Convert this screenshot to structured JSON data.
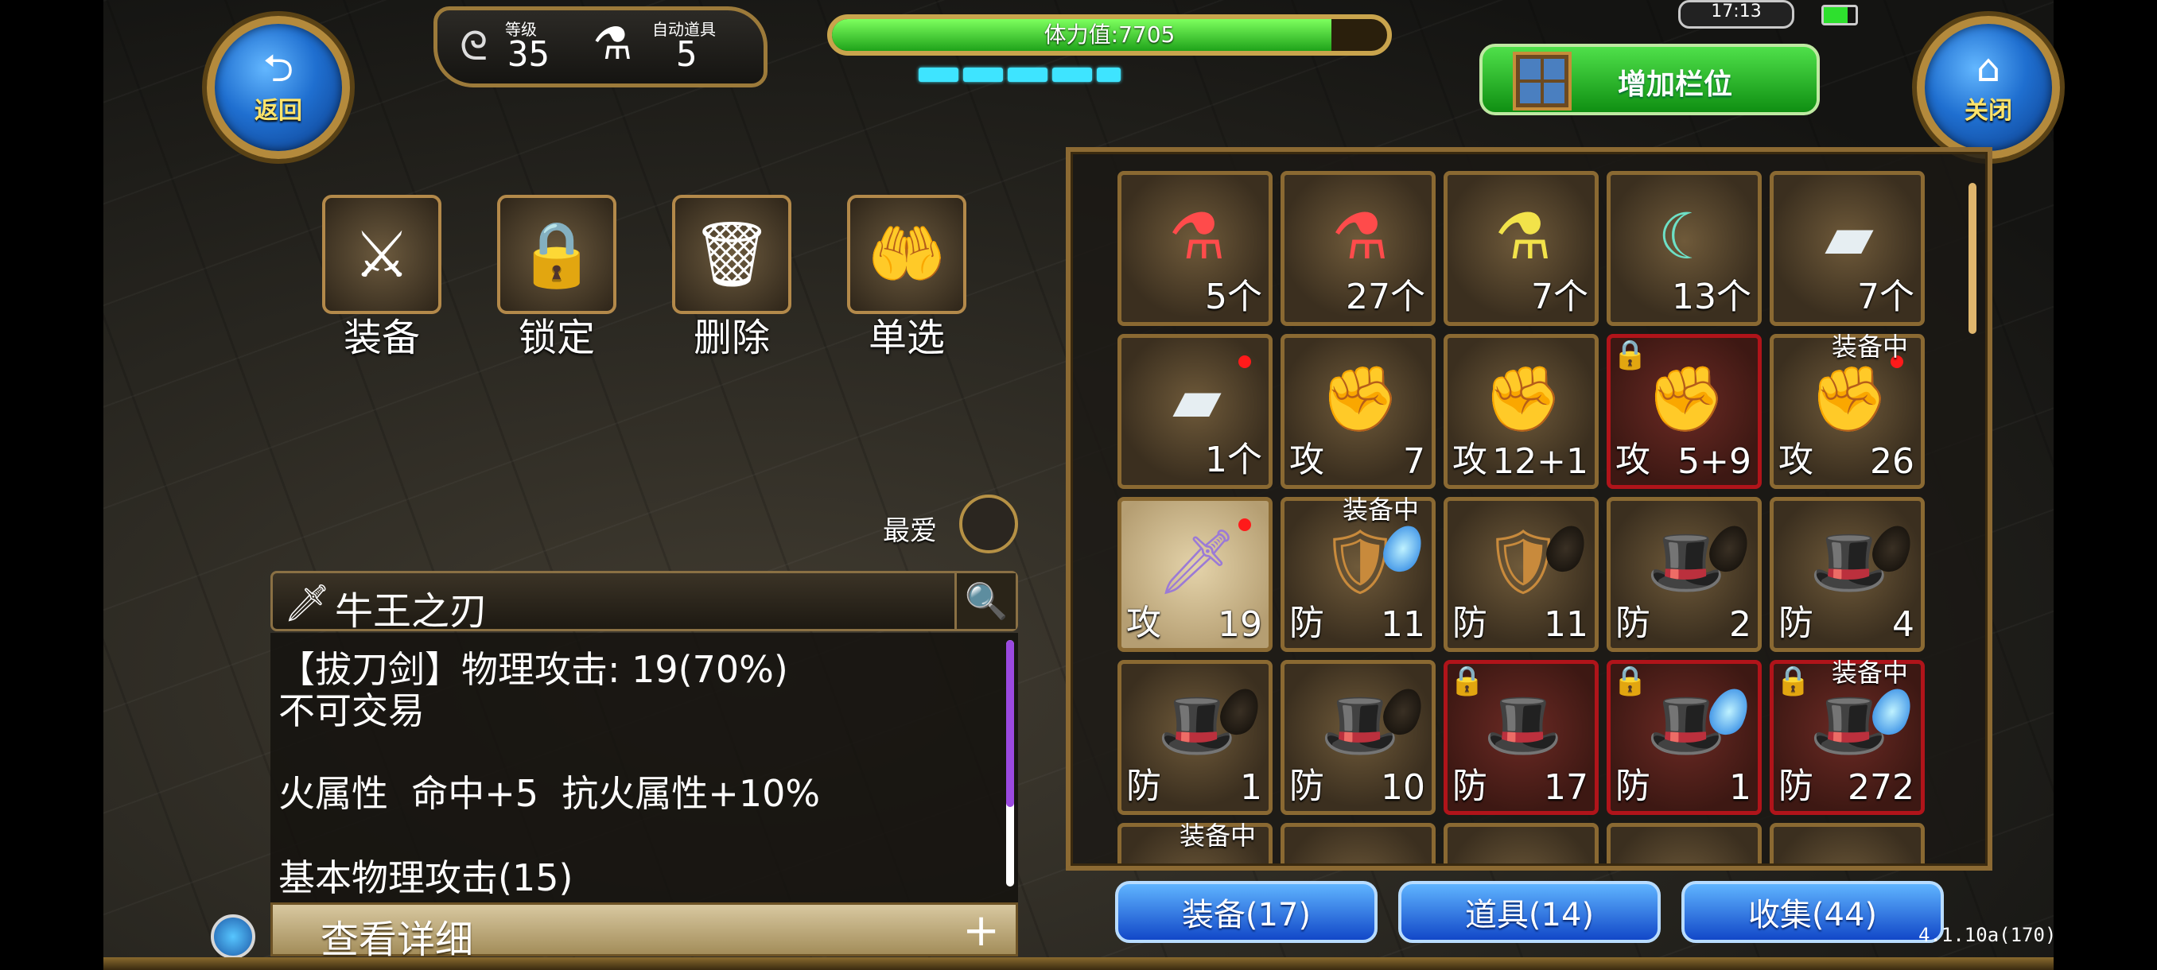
{
  "topbar": {
    "back_label": "返回",
    "close_label": "关闭",
    "level_label": "等级",
    "level_value": "35",
    "auto_item_label": "自动道具",
    "auto_item_value": "5",
    "stamina_text": "体力值:7705",
    "stamina_fill": 0.9,
    "clock": "17:13",
    "add_slot_label": "增加栏位"
  },
  "actions": [
    {
      "label": "装备"
    },
    {
      "label": "锁定"
    },
    {
      "label": "删除"
    },
    {
      "label": "单选"
    }
  ],
  "favorite_label": "最爱",
  "detail": {
    "item_name": "牛王之刃",
    "lines": [
      "【拔刀剑】物理攻击: 19(70%)",
      "不可交易",
      "",
      "火属性  命中+5  抗火属性+10%",
      "",
      "基本物理攻击(15)"
    ],
    "view_detail_label": "查看详细",
    "plus_label": "+"
  },
  "inventory": {
    "equipped_label": "装备中",
    "rows": [
      [
        {
          "icon": "red-potion",
          "count": "5个"
        },
        {
          "icon": "red-potion",
          "count": "27个"
        },
        {
          "icon": "yellow-potion",
          "count": "7个"
        },
        {
          "icon": "crescent-blade",
          "count": "13个"
        },
        {
          "icon": "metal-ingot",
          "count": "7个"
        }
      ],
      [
        {
          "icon": "metal-ingot",
          "count": "1个",
          "dot": true
        },
        {
          "icon": "gauntlet",
          "type": "攻",
          "count": "7"
        },
        {
          "icon": "gauntlet",
          "type": "攻",
          "count": "12+1"
        },
        {
          "icon": "gauntlet",
          "type": "攻",
          "count": "5+9",
          "locked": true
        },
        {
          "icon": "gauntlet",
          "type": "攻",
          "count": "26",
          "dot": true,
          "equipped": true
        }
      ],
      [
        {
          "icon": "sword",
          "type": "攻",
          "count": "19",
          "dot": true,
          "selected": true
        },
        {
          "icon": "armor",
          "type": "防",
          "count": "11",
          "gem": "blue",
          "equipped": true
        },
        {
          "icon": "armor",
          "type": "防",
          "count": "11",
          "gem": "dark"
        },
        {
          "icon": "wizard-hat",
          "type": "防",
          "count": "2",
          "gem": "dark"
        },
        {
          "icon": "wizard-hat",
          "type": "防",
          "count": "4",
          "gem": "dark"
        }
      ],
      [
        {
          "icon": "wizard-hat",
          "type": "防",
          "count": "1",
          "gem": "dark"
        },
        {
          "icon": "wizard-hat",
          "type": "防",
          "count": "10",
          "gem": "dark"
        },
        {
          "icon": "wizard-hat",
          "type": "防",
          "count": "17",
          "locked": true
        },
        {
          "icon": "wizard-hat",
          "type": "防",
          "count": "1",
          "gem": "blue",
          "locked": true
        },
        {
          "icon": "wizard-hat",
          "type": "防",
          "count": "272",
          "gem": "blue",
          "locked": true,
          "equipped": true
        }
      ],
      [
        {
          "icon": "",
          "count": "",
          "equipped": true
        },
        {
          "icon": "",
          "count": ""
        },
        {
          "icon": "",
          "count": ""
        },
        {
          "icon": "",
          "count": ""
        },
        {
          "icon": "",
          "count": ""
        }
      ]
    ]
  },
  "tabs": [
    {
      "label": "装备(17)"
    },
    {
      "label": "道具(14)"
    },
    {
      "label": "收集(44)"
    }
  ],
  "version": "4.1.10a(170)",
  "colors": {
    "accent_gold": "#b48a3c",
    "button_blue": "#1f6fd0",
    "slot_locked": "#b0141a",
    "add_slot_green": "#0f8f12"
  }
}
